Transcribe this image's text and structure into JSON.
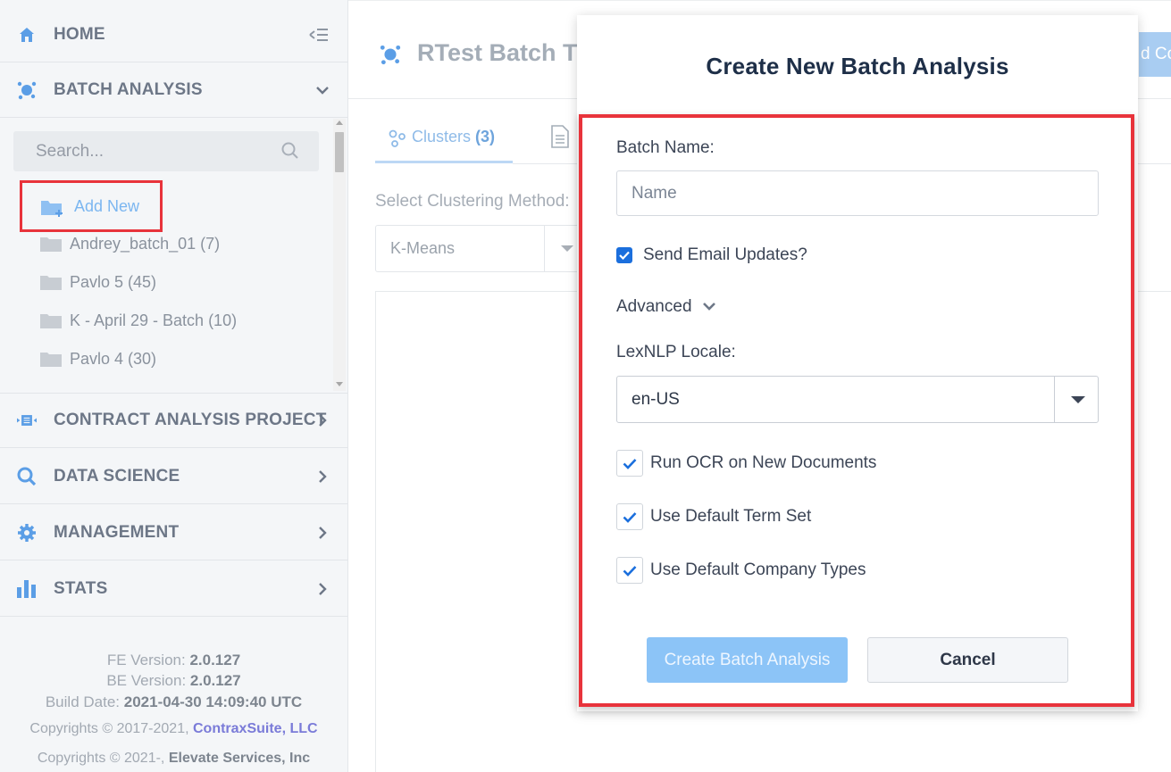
{
  "sidebar": {
    "home": {
      "label": "HOME"
    },
    "batch_analysis": {
      "label": "BATCH ANALYSIS",
      "search_placeholder": "Search...",
      "add_new_label": "Add New",
      "items": [
        {
          "label": "Andrey_batch_01 (7)"
        },
        {
          "label": "Pavlo 5 (45)"
        },
        {
          "label": "K - April 29 - Batch (10)"
        },
        {
          "label": "Pavlo 4 (30)"
        }
      ]
    },
    "contract_analysis": {
      "label": "CONTRACT ANALYSIS PROJECT"
    },
    "data_science": {
      "label": "DATA SCIENCE"
    },
    "management": {
      "label": "MANAGEMENT"
    },
    "stats": {
      "label": "STATS"
    },
    "footer": {
      "fe_label": "FE Version:",
      "fe_value": "2.0.127",
      "be_label": "BE Version:",
      "be_value": "2.0.127",
      "build_label": "Build Date:",
      "build_value": "2021-04-30 14:09:40 UTC",
      "copyright1_prefix": "Copyrights © 2017-2021,",
      "copyright1_link": "ContraxSuite, LLC",
      "copyright2_prefix": "Copyrights © 2021-,",
      "copyright2_company": "Elevate Services, Inc"
    }
  },
  "main": {
    "title": "RTest Batch Ti",
    "header_button": "d Co",
    "tabs": {
      "clusters_label": "Clusters",
      "clusters_count": "(3)"
    },
    "clustering_method_label": "Select Clustering Method:",
    "clustering_method_value": "K-Means"
  },
  "modal": {
    "title": "Create New Batch Analysis",
    "batch_name_label": "Batch Name:",
    "batch_name_placeholder": "Name",
    "send_email_label": "Send Email Updates?",
    "send_email_checked": true,
    "advanced_label": "Advanced",
    "locale_label": "LexNLP Locale:",
    "locale_value": "en-US",
    "options": [
      {
        "label": "Run OCR on New Documents",
        "checked": true
      },
      {
        "label": "Use Default Term Set",
        "checked": true
      },
      {
        "label": "Use Default Company Types",
        "checked": true
      }
    ],
    "create_button": "Create Batch Analysis",
    "cancel_button": "Cancel"
  },
  "colors": {
    "accent": "#1b6fdd",
    "highlight_border": "#e8333b",
    "primary_button": "#8cc4f7"
  }
}
